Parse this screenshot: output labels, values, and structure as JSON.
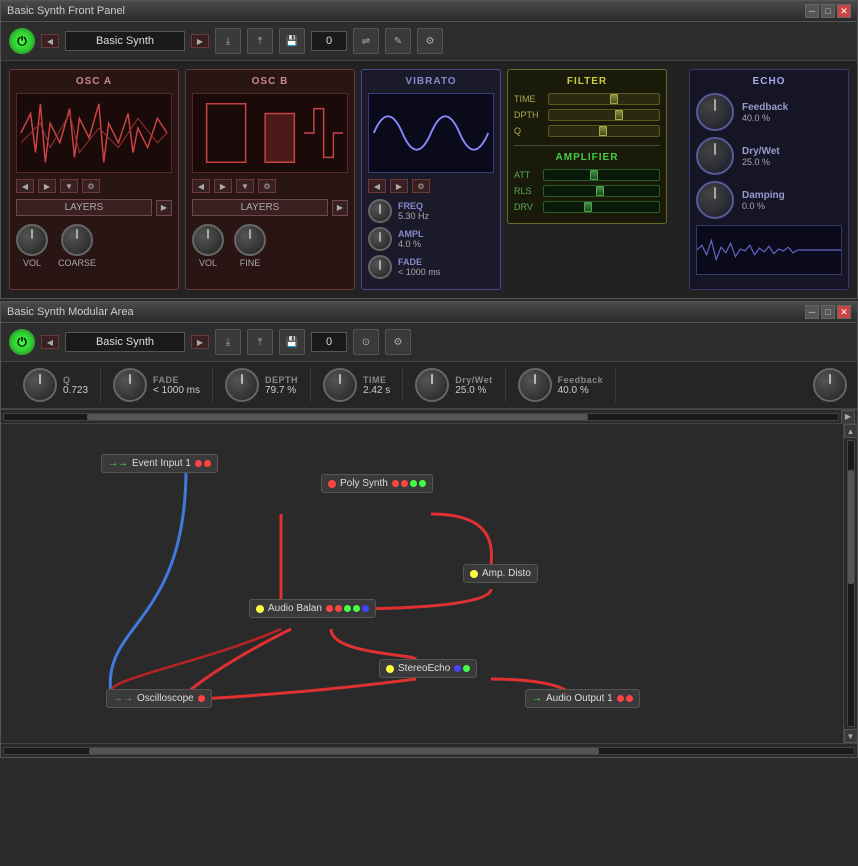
{
  "frontPanel": {
    "title": "Basic Synth Front Panel",
    "presetName": "Basic Synth",
    "presetNum": "0",
    "oscA": {
      "title": "OSC A",
      "layers": "LAYERS",
      "vol": "VOL",
      "coarse": "COARSE"
    },
    "oscB": {
      "title": "OSC B",
      "layers": "LAYERS",
      "vol": "VOL",
      "fine": "FINE"
    },
    "vibrato": {
      "title": "VIBRATO",
      "freq": "FREQ",
      "freqVal": "5.30 Hz",
      "ampl": "AMPL",
      "amplVal": "4.0 %",
      "fade": "FADE",
      "fadeVal": "< 1000 ms"
    },
    "filter": {
      "title": "FILTER",
      "time": "TIME",
      "dpth": "DPTH",
      "q": "Q",
      "timePos": "55%",
      "dpthPos": "60%",
      "qPos": "45%"
    },
    "amplifier": {
      "title": "AMPLIFIER",
      "att": "ATT",
      "rls": "RLS",
      "drv": "DRV",
      "attPos": "40%",
      "rlsPos": "45%",
      "drvPos": "35%"
    },
    "echo": {
      "title": "ECHO",
      "feedback": "Feedback",
      "feedbackVal": "40.0 %",
      "dryWet": "Dry/Wet",
      "dryWetVal": "25.0 %",
      "damping": "Damping",
      "dampingVal": "0.0 %"
    }
  },
  "modularArea": {
    "title": "Basic Synth Modular Area",
    "presetName": "Basic Synth",
    "presetNum": "0",
    "strip": {
      "q": {
        "name": "Q",
        "value": "0.723"
      },
      "fade": {
        "name": "FADE",
        "value": "< 1000 ms"
      },
      "depth": {
        "name": "DEPTH",
        "value": "79.7 %"
      },
      "time": {
        "name": "TIME",
        "value": "2.42 s"
      },
      "dryWet": {
        "name": "Dry/Wet",
        "value": "25.0 %"
      },
      "feedback": {
        "name": "Feedback",
        "value": "40.0 %"
      }
    },
    "modules": {
      "eventInput": "Event Input 1",
      "polySynth": "Poly Synth",
      "ampDisto": "Amp. Disto",
      "audioBalan": "Audio Balan",
      "stereoEcho": "StereoEcho",
      "oscilloscope": "Oscilloscope",
      "audioOutput": "Audio Output 1"
    }
  }
}
